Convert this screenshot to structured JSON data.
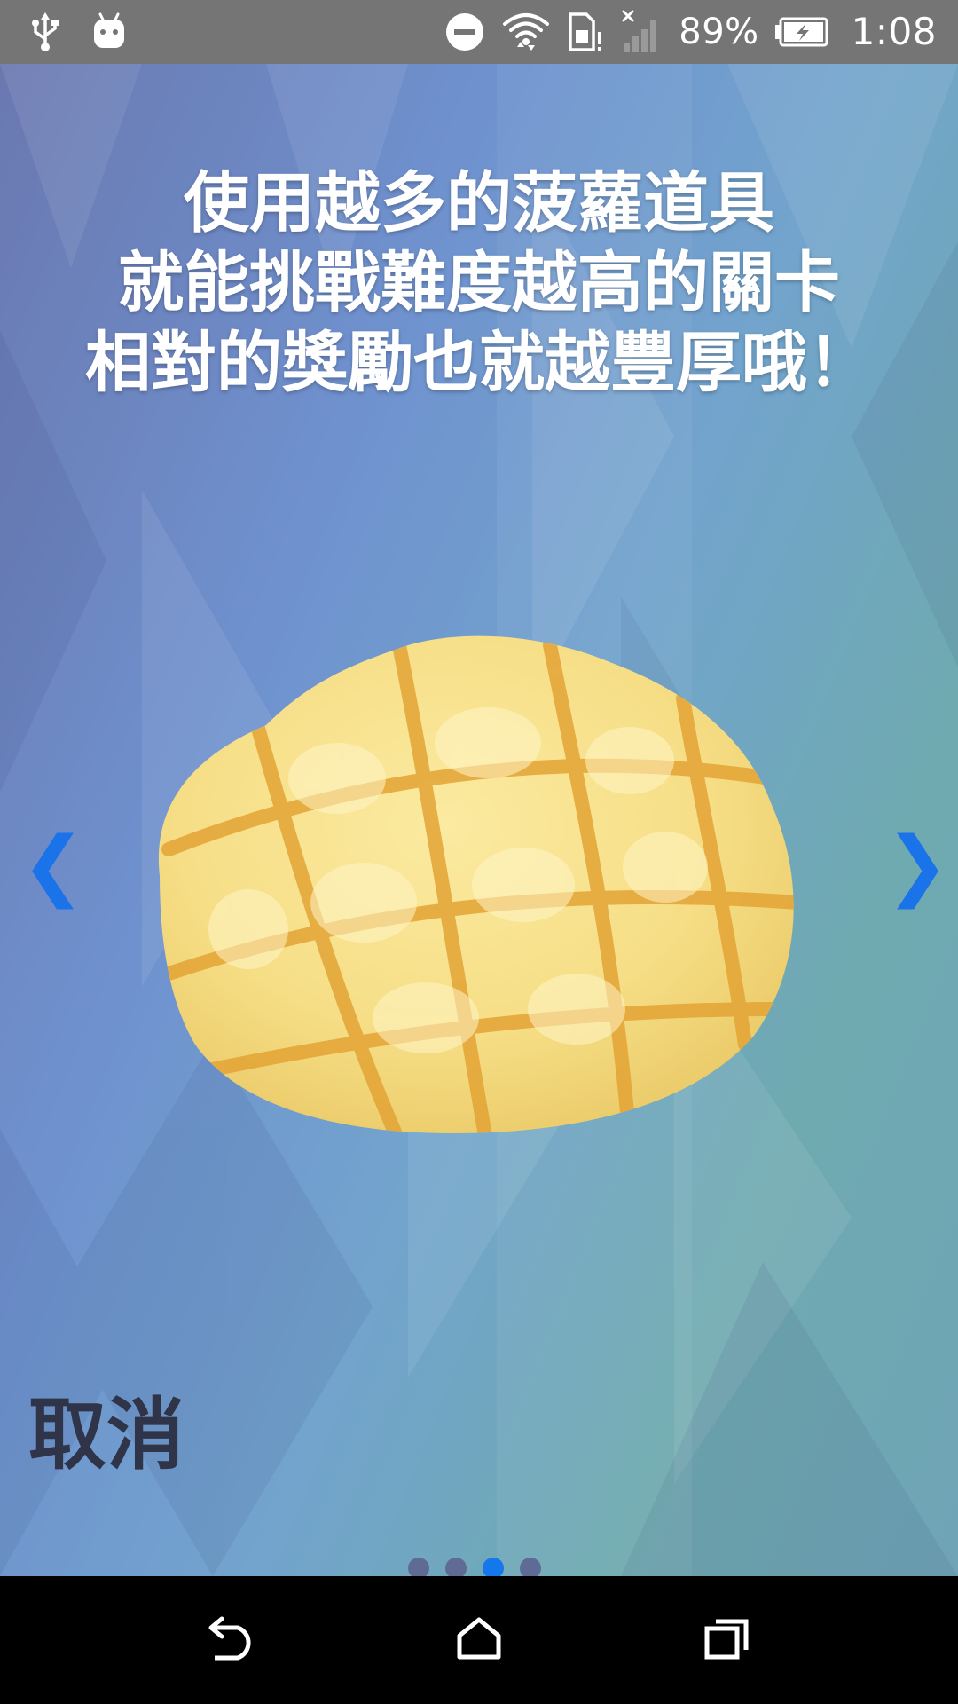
{
  "status_bar": {
    "battery_percent": "89%",
    "clock": "1:08",
    "icons": [
      "usb-icon",
      "android-debug-icon",
      "do-not-disturb-icon",
      "wifi-icon",
      "sim-card-alert-icon",
      "signal-no-service-icon",
      "battery-charging-icon"
    ]
  },
  "onboarding": {
    "headline_lines": [
      "使用越多的菠蘿道具",
      "就能挑戰難度越高的關卡",
      "相對的獎勵也就越豐厚哦！"
    ],
    "image_icon": "pineapple-bun-illustration",
    "prev_arrow": "❮",
    "next_arrow": "❯",
    "cancel_label": "取消",
    "page_count": 4,
    "current_page": 3
  },
  "colors": {
    "arrow": "#1a73e8",
    "dot_active": "#1577ec",
    "dot_inactive": "#5f6b95",
    "cancel_text": "#2f3448",
    "status_bar_bg": "#757575",
    "nav_bar_bg": "#000000"
  },
  "nav_bar": {
    "icons": [
      "back-icon",
      "home-icon",
      "recents-icon"
    ]
  }
}
